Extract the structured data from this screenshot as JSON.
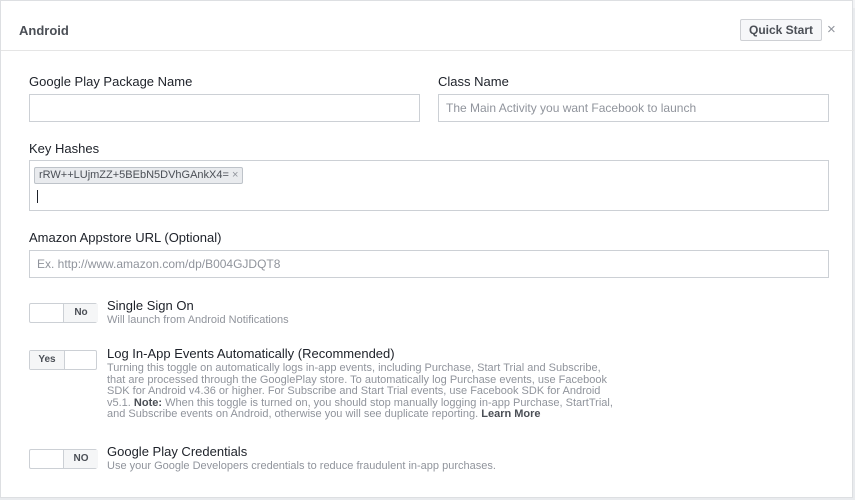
{
  "header": {
    "title": "Android",
    "quick_start": "Quick Start",
    "close_glyph": "×"
  },
  "fields": {
    "package_name": {
      "label": "Google Play Package Name",
      "value": ""
    },
    "class_name": {
      "label": "Class Name",
      "placeholder": "The Main Activity you want Facebook to launch"
    },
    "key_hashes": {
      "label": "Key Hashes",
      "tags": [
        "rRW++LUjmZZ+5BEbN5DVhGAnkX4="
      ],
      "tag_remove": "×"
    },
    "amazon_url": {
      "label": "Amazon Appstore URL (Optional)",
      "placeholder": "Ex. http://www.amazon.com/dp/B004GJDQT8"
    }
  },
  "options": {
    "sso": {
      "title": "Single Sign On",
      "description": "Will launch from Android Notifications",
      "toggle_label": "No",
      "state": "off"
    },
    "log_events": {
      "title": "Log In-App Events Automatically (Recommended)",
      "description_lines": [
        "Turning this toggle on automatically logs in-app events, including Purchase, Start Trial and Subscribe,",
        "that are processed through the GooglePlay store. To automatically log Purchase events, use Facebook",
        "SDK for Android v4.36 or higher. For Subscribe and Start Trial events, use Facebook SDK for Android"
      ],
      "note_line_start": "v5.1.",
      "note_label": "Note:",
      "note_line_rest": "When this toggle is turned on, you should stop manually logging in-app Purchase, StartTrial,",
      "last_line": "and Subscribe events on Android, otherwise you will see duplicate reporting.",
      "learn_more": "Learn More",
      "toggle_label": "Yes",
      "state": "on"
    },
    "credentials": {
      "title": "Google Play Credentials",
      "description": "Use your Google Developers credentials to reduce fraudulent in-app purchases.",
      "toggle_label": "NO",
      "state": "off"
    }
  }
}
